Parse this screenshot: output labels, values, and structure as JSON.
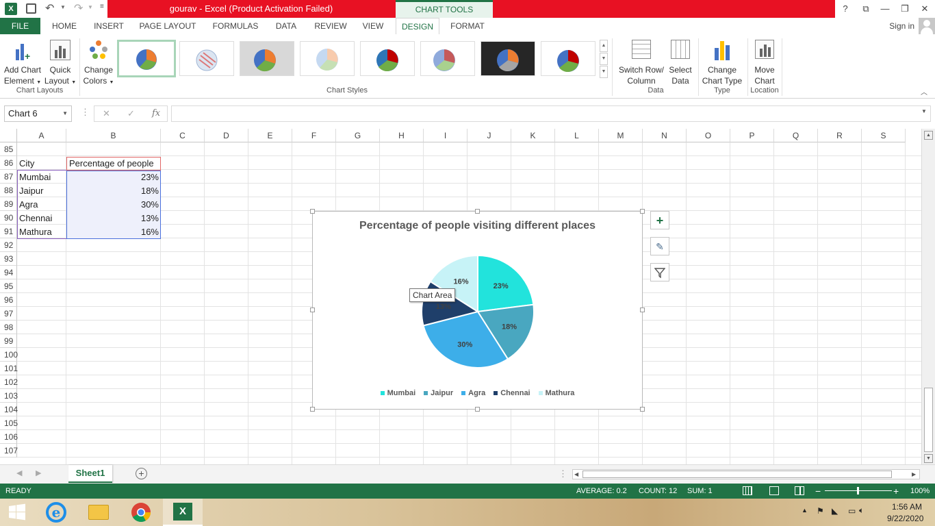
{
  "title_bar": {
    "title": "gourav  -  Excel (Product Activation Failed)",
    "context_tab": "CHART TOOLS",
    "help": "?"
  },
  "tabs": [
    {
      "label": "FILE"
    },
    {
      "label": "HOME"
    },
    {
      "label": "INSERT"
    },
    {
      "label": "PAGE LAYOUT"
    },
    {
      "label": "FORMULAS"
    },
    {
      "label": "DATA"
    },
    {
      "label": "REVIEW"
    },
    {
      "label": "VIEW"
    },
    {
      "label": "DESIGN"
    },
    {
      "label": "FORMAT"
    }
  ],
  "sign_in": "Sign in",
  "ribbon": {
    "add_chart_element": [
      "Add Chart",
      "Element"
    ],
    "quick_layout": [
      "Quick",
      "Layout"
    ],
    "change_colors": [
      "Change",
      "Colors"
    ],
    "switch_row_column": [
      "Switch Row/",
      "Column"
    ],
    "select_data": [
      "Select",
      "Data"
    ],
    "change_chart_type": [
      "Change",
      "Chart Type"
    ],
    "move_chart": [
      "Move",
      "Chart"
    ],
    "groups": {
      "chart_layouts": "Chart Layouts",
      "chart_styles": "Chart Styles",
      "data": "Data",
      "type": "Type",
      "location": "Location"
    }
  },
  "formula_bar": {
    "name_box": "Chart 6",
    "fx": "fx",
    "value": ""
  },
  "columns": [
    "A",
    "B",
    "C",
    "D",
    "E",
    "F",
    "G",
    "H",
    "I",
    "J",
    "K",
    "L",
    "M",
    "N",
    "O",
    "P",
    "Q",
    "R",
    "S"
  ],
  "rows": [
    "85",
    "86",
    "87",
    "88",
    "89",
    "90",
    "91",
    "92",
    "93",
    "94",
    "95",
    "96",
    "97",
    "98",
    "99",
    "100",
    "101",
    "102",
    "103",
    "104",
    "105",
    "106",
    "107"
  ],
  "table": {
    "header": [
      "City",
      "Percentage of people"
    ],
    "rows": [
      [
        "Mumbai",
        "23%"
      ],
      [
        "Jaipur",
        "18%"
      ],
      [
        "Agra",
        "30%"
      ],
      [
        "Chennai",
        "13%"
      ],
      [
        "Mathura",
        "16%"
      ]
    ]
  },
  "chart_data": {
    "type": "pie",
    "title": "Percentage of people visiting different places",
    "categories": [
      "Mumbai",
      "Jaipur",
      "Agra",
      "Chennai",
      "Mathura"
    ],
    "values": [
      23,
      18,
      30,
      13,
      16
    ],
    "data_labels": [
      "23%",
      "18%",
      "30%",
      "13%",
      "16%"
    ],
    "colors": [
      "#22e3dc",
      "#49a7c0",
      "#3daee9",
      "#1f3f6a",
      "#c7f3f7"
    ],
    "legend": "bottom"
  },
  "tooltip": "Chart Area",
  "sheet": {
    "tab": "Sheet1"
  },
  "status": {
    "ready": "READY",
    "average": "AVERAGE: 0.2",
    "count": "COUNT: 12",
    "sum": "SUM: 1",
    "zoom": "100%"
  },
  "taskbar": {
    "time": "1:56 AM",
    "date": "9/22/2020"
  }
}
